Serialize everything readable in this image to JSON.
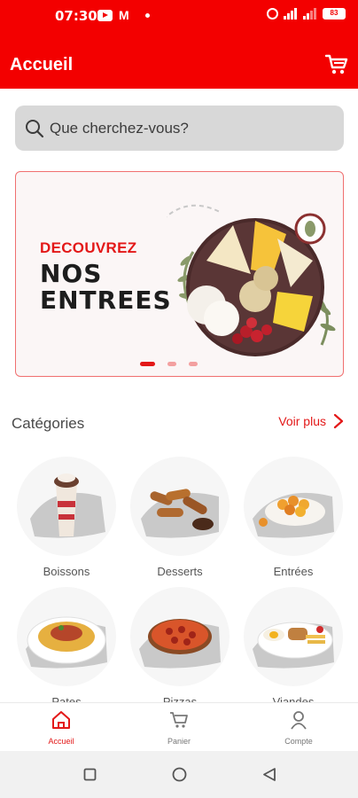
{
  "status_bar": {
    "time": "07:30",
    "battery": "83"
  },
  "header": {
    "title": "Accueil",
    "cart_icon": "cart-icon"
  },
  "search": {
    "placeholder": "Que cherchez-vous?"
  },
  "banner": {
    "kicker": "DECOUVREZ",
    "line1": "NOS",
    "line2": "ENTREES",
    "active_slide": 1,
    "slide_count": 3,
    "accent": "#e31818"
  },
  "categories": {
    "title": "Catégories",
    "see_more": "Voir plus",
    "items": [
      {
        "label": "Boissons"
      },
      {
        "label": "Desserts"
      },
      {
        "label": "Entrées"
      },
      {
        "label": "Pates"
      },
      {
        "label": "Pizzas"
      },
      {
        "label": "Viandes"
      }
    ]
  },
  "bottom_nav": {
    "items": [
      {
        "label": "Accueil",
        "icon": "home-icon",
        "active": true
      },
      {
        "label": "Panier",
        "icon": "cart-icon",
        "active": false
      },
      {
        "label": "Compte",
        "icon": "user-icon",
        "active": false
      }
    ]
  },
  "colors": {
    "primary": "#f30000",
    "accent": "#e31818"
  }
}
